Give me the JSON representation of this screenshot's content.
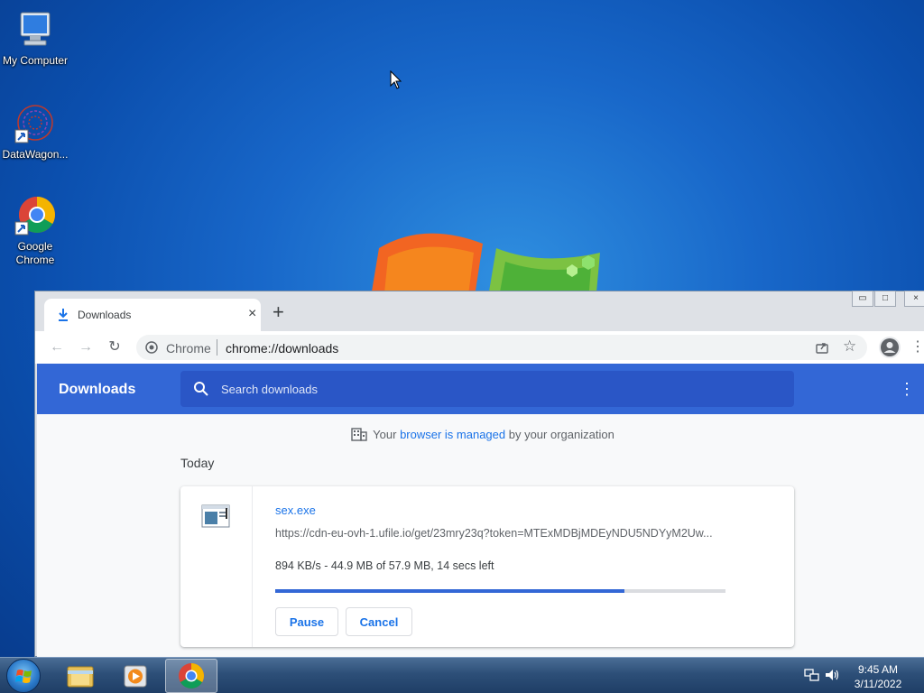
{
  "desktop": {
    "icons": [
      {
        "label": "My Computer"
      },
      {
        "label": "DataWagon..."
      },
      {
        "label": "Google Chrome"
      }
    ]
  },
  "browser": {
    "tab": {
      "title": "Downloads",
      "close": "×"
    },
    "new_tab": "+",
    "omnibox": {
      "scheme": "Chrome",
      "url": "chrome://downloads"
    },
    "window_controls": {
      "minimize": "▭",
      "maximize": "□",
      "close": "×"
    }
  },
  "downloads_page": {
    "title": "Downloads",
    "search_placeholder": "Search downloads",
    "managed": {
      "prefix": "Your ",
      "link": "browser is managed",
      "suffix": " by your organization"
    },
    "section_date": "Today",
    "item": {
      "file_name": "sex.exe",
      "url": "https://cdn-eu-ovh-1.ufile.io/get/23mry23q?token=MTExMDBjMDEyNDU5NDYyM2Uw...",
      "status": "894 KB/s - 44.9 MB of 57.9 MB, 14 secs left",
      "progress_fraction": 0.775,
      "pause_label": "Pause",
      "cancel_label": "Cancel"
    }
  },
  "taskbar": {
    "time": "9:45 AM",
    "date": "3/11/2022"
  },
  "colors": {
    "header_blue": "#3367d6",
    "link_blue": "#1a73e8"
  }
}
